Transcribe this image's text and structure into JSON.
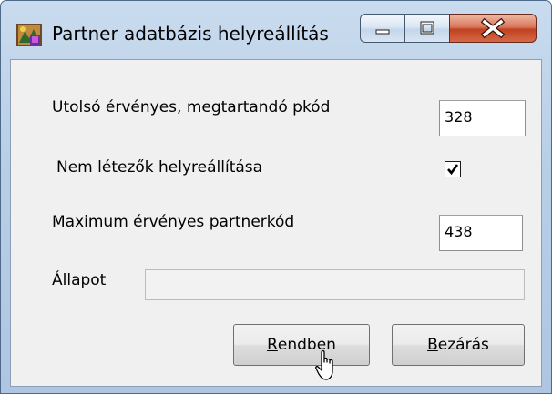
{
  "window": {
    "title": "Partner adatbázis helyreállítás",
    "app_icon": "database-restore-icon",
    "caption_buttons": [
      "minimize-icon",
      "maximize-icon",
      "close-icon"
    ]
  },
  "form": {
    "last_valid_label": "Utolsó érvényes, megtartandó pkód",
    "last_valid_value": "328",
    "restore_missing_label": "Nem létezők helyreállítása",
    "restore_missing_checked": true,
    "max_valid_label": "Maximum érvényes partnerkód",
    "max_valid_value": "438",
    "status_label": "Állapot",
    "status_progress": 0
  },
  "buttons": {
    "ok": {
      "accel": "R",
      "rest": "endben"
    },
    "close": {
      "accel": "B",
      "rest": "ezárás"
    }
  },
  "colors": {
    "frame": "#b9cfe8",
    "close_button": "#c04120",
    "client_area": "#f0f0f0"
  }
}
